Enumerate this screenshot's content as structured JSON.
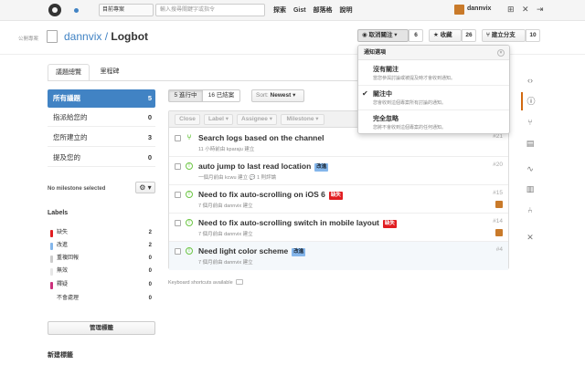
{
  "header": {
    "scope_select": "目前專案",
    "search_placeholder": "輸入搜尋關鍵字或指令",
    "nav": [
      "探索",
      "Gist",
      "部落格",
      "說明"
    ],
    "username": "dannvix"
  },
  "repo": {
    "visibility": "公開專案",
    "owner": "dannvix",
    "separator": " / ",
    "name": "Logbot",
    "watch_label": "◉ 取消關注 ▾",
    "watch_count": "6",
    "star_label": "★ 收藏",
    "star_count": "26",
    "fork_label": "⑂ 建立分支",
    "fork_count": "10"
  },
  "tabs": [
    {
      "label": "議題總覽",
      "active": true
    },
    {
      "label": "里程碑",
      "active": false
    }
  ],
  "filters": [
    {
      "label": "所有議題",
      "count": "5"
    },
    {
      "label": "指派給您的",
      "count": "0"
    },
    {
      "label": "您所建立的",
      "count": "3"
    },
    {
      "label": "提及您的",
      "count": "0"
    }
  ],
  "milestone": {
    "text": "No milestone selected",
    "gear": "⚙ ▾"
  },
  "labels": {
    "heading": "Labels",
    "items": [
      {
        "name": "缺失",
        "count": "2",
        "color": "#e11d21"
      },
      {
        "name": "改進",
        "count": "2",
        "color": "#84b6eb"
      },
      {
        "name": "重複回報",
        "count": "0",
        "color": "#cccccc"
      },
      {
        "name": "無效",
        "count": "0",
        "color": "#e6e6e6"
      },
      {
        "name": "釋疑",
        "count": "0",
        "color": "#cc317c"
      },
      {
        "name": "不會處理",
        "count": "0",
        "color": "#ffffff"
      }
    ],
    "manage_button": "管理標籤",
    "new_label_heading": "新建標籤"
  },
  "toolbar": {
    "open_label": "5 進行中",
    "closed_label": "16 已結案",
    "sort_prefix": "Sort: ",
    "sort_value": "Newest ▾"
  },
  "actions": [
    "Close",
    "Label ▾",
    "Assignee ▾",
    "Milestone ▾"
  ],
  "issues": [
    {
      "title": "Search logs based on the channel",
      "meta": "11 小時前由 kparaju 建立",
      "number": "#21",
      "badge": "",
      "badge_color": "",
      "badge_text_color": "",
      "type": "pr"
    },
    {
      "title": "auto jump to last read location",
      "meta": "一個月前由 kcwu 建立  💬 1 則評論",
      "number": "#20",
      "badge": "改進",
      "badge_color": "#84b6eb",
      "badge_text_color": "#1c2733",
      "type": "issue"
    },
    {
      "title": "Need to fix auto-scrolling on iOS 6",
      "meta": "7 個月前由 dannvix 建立",
      "number": "#15",
      "badge": "缺失",
      "badge_color": "#e11d21",
      "badge_text_color": "#ffffff",
      "type": "issue"
    },
    {
      "title": "Need to fix auto-scrolling switch in mobile layout",
      "meta": "7 個月前由 dannvix 建立",
      "number": "#14",
      "badge": "缺失",
      "badge_color": "#e11d21",
      "badge_text_color": "#ffffff",
      "type": "issue"
    },
    {
      "title": "Need light color scheme",
      "meta": "7 個月前由 dannvix 建立",
      "number": "#4",
      "badge": "改進",
      "badge_color": "#84b6eb",
      "badge_text_color": "#1c2733",
      "type": "issue"
    }
  ],
  "keyboard_shortcuts": "Keyboard shortcuts available",
  "dropdown": {
    "header": "通知選項",
    "items": [
      {
        "title": "沒有關注",
        "desc": "當您參與討論或被提及時才會收到通知。",
        "checked": false
      },
      {
        "title": "關注中",
        "desc": "您會收到這個專案所有討論的通知。",
        "checked": true
      },
      {
        "title": "完全忽略",
        "desc": "您將不會收到這個專案的任何通知。",
        "checked": false
      }
    ]
  },
  "colors": {
    "accent": "#4183c4",
    "open_green": "#6cc644",
    "active_orange": "#d26911"
  },
  "icons": {
    "right_nav": [
      "code-icon",
      "issue-icon",
      "pull-request-icon",
      "wiki-icon",
      "pulse-icon",
      "graph-icon",
      "network-icon",
      "settings-icon"
    ]
  }
}
